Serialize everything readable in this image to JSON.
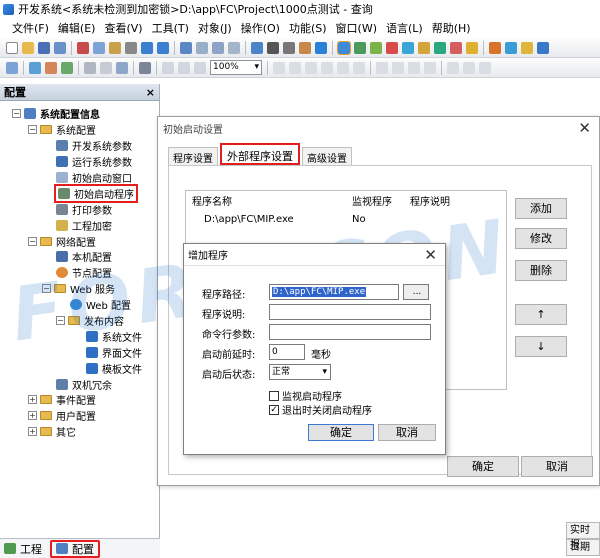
{
  "window": {
    "title": "开发系统<系统未检测到加密锁>D:\\app\\FC\\Project\\1000点测试 - 查询"
  },
  "menu": [
    "文件(F)",
    "编辑(E)",
    "查看(V)",
    "工具(T)",
    "对象(J)",
    "操作(O)",
    "功能(S)",
    "窗口(W)",
    "语言(L)",
    "帮助(H)"
  ],
  "toolbar": {
    "zoom": "100%"
  },
  "panel": {
    "title": "配置",
    "close": "×",
    "tree": {
      "root": "系统配置信息",
      "sys": "系统配置",
      "dev": "开发系统参数",
      "run": "运行系统参数",
      "initwin": "初始启动窗口",
      "initprog": "初始启动程序",
      "print": "打印参数",
      "encrypt": "工程加密",
      "net": "网络配置",
      "local": "本机配置",
      "nodes": "节点配置",
      "web": "Web 服务",
      "webcfg": "Web 配置",
      "publish": "发布内容",
      "sysfile": "系统文件",
      "ifile": "界面文件",
      "tfile": "模板文件",
      "dual": "双机冗余",
      "events": "事件配置",
      "users": "用户配置",
      "other": "其它"
    },
    "footer": {
      "project": "工程",
      "config": "配置"
    }
  },
  "dialog": {
    "title": "初始启动设置",
    "tabs": [
      "程序设置",
      "外部程序设置",
      "高级设置"
    ],
    "columns": [
      "程序名称",
      "监视程序",
      "程序说明"
    ],
    "rows": [
      {
        "name": "D:\\app\\FC\\MIP.exe",
        "monitor": "No",
        "desc": ""
      }
    ],
    "buttons": {
      "add": "添加",
      "modify": "修改",
      "delete": "删除",
      "up": "↑",
      "down": "↓",
      "ok": "确定",
      "cancel": "取消"
    }
  },
  "add_dialog": {
    "title": "增加程序",
    "fields": {
      "path_label": "程序路径:",
      "path_value": "D:\\app\\FC\\MIP.exe",
      "browse": "...",
      "desc_label": "程序说明:",
      "args_label": "命令行参数:",
      "delay_label": "启动前延时:",
      "delay_value": "0",
      "delay_unit": "毫秒",
      "state_label": "启动后状态:",
      "state_value": "正常"
    },
    "checks": [
      {
        "label": "监视启动程序",
        "checked": false
      },
      {
        "label": "退出时关闭启动程序",
        "checked": true
      }
    ],
    "buttons": {
      "ok": "确定",
      "cancel": "取消"
    }
  },
  "statusbar": {
    "realtime": "实时报",
    "date": "日期"
  },
  "watermark": "FORCECON"
}
